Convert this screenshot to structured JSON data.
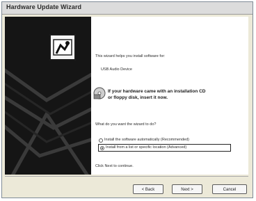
{
  "window": {
    "title": "Hardware Update Wizard"
  },
  "intro": {
    "line1": "This wizard helps you install software for:",
    "device": "USB Audio Device",
    "cd_prompt": "If your hardware came with an installation CD",
    "cd_prompt2": "or floppy disk, insert it now."
  },
  "question": "What do you want the wizard to do?",
  "options": [
    {
      "label": "Install the software automatically (Recommended)",
      "selected": false
    },
    {
      "label": "Install from a list or specific location (Advanced)",
      "selected": true
    }
  ],
  "hint": "Click Next to continue.",
  "buttons": {
    "back": "< Back",
    "next": "Next >",
    "cancel": "Cancel"
  },
  "icons": {
    "wizard": "hardware-wizard-icon",
    "cd": "cd-disk-icon"
  }
}
